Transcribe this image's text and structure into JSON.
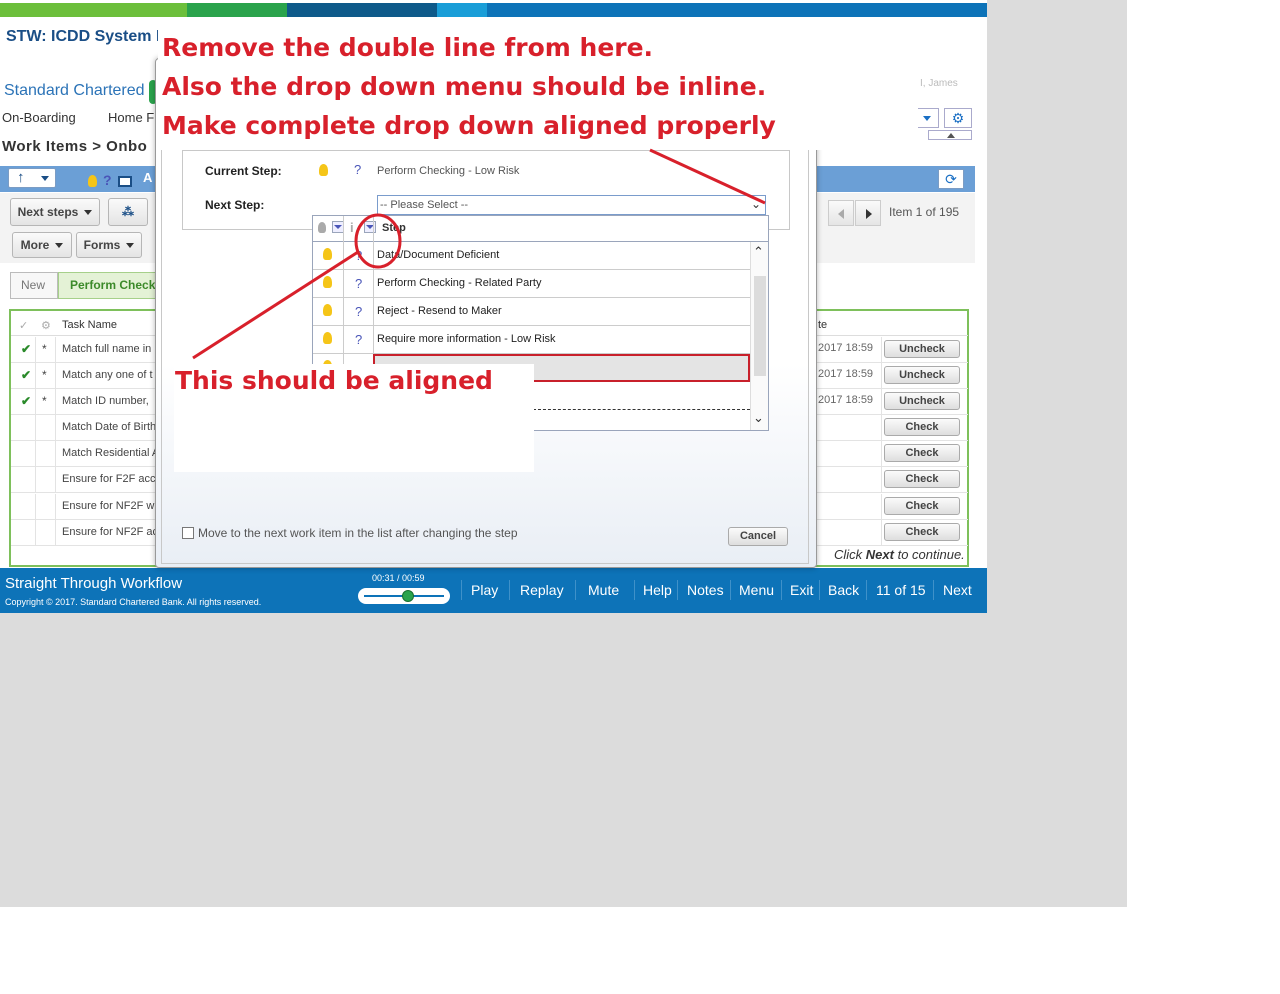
{
  "app": {
    "title": "STW: ICDD System D",
    "brand": "Standard Chartered",
    "user": "I, James"
  },
  "nav": {
    "onboarding": "On-Boarding",
    "home": "Home F"
  },
  "breadcrumb": "Work Items > Onbo",
  "toolbar": {
    "next_steps": "Next steps",
    "more": "More",
    "forms": "Forms",
    "pager_text": "Item 1 of 195"
  },
  "steps": {
    "new": "New",
    "perform": "Perform Check"
  },
  "task_table": {
    "header": {
      "task_name": "Task Name",
      "date": "te"
    },
    "rows": [
      {
        "checked": "✔",
        "star": "*",
        "name": "Match full name in",
        "date": "2017 18:59",
        "action": "Uncheck"
      },
      {
        "checked": "✔",
        "star": "*",
        "name": "Match any one of t",
        "date": "2017 18:59",
        "action": "Uncheck"
      },
      {
        "checked": "✔",
        "star": "*",
        "name": "Match ID number,",
        "date": "2017 18:59",
        "action": "Uncheck"
      },
      {
        "checked": "",
        "star": "",
        "name": "Match Date of Birth",
        "date": "",
        "action": "Check"
      },
      {
        "checked": "",
        "star": "",
        "name": "Match Residential A",
        "date": "",
        "action": "Check"
      },
      {
        "checked": "",
        "star": "",
        "name": "Ensure for F2F acc",
        "date": "",
        "action": "Check"
      },
      {
        "checked": "",
        "star": "",
        "name": "Ensure for NF2F wi",
        "date": "",
        "action": "Check"
      },
      {
        "checked": "",
        "star": "",
        "name": "Ensure for NF2F ac",
        "date": "",
        "action": "Check"
      }
    ]
  },
  "dialog": {
    "current_step_label": "Current Step:",
    "current_step_value": "Perform Checking - Low Risk",
    "next_step_label": "Next Step:",
    "select_placeholder": "-- Please Select --",
    "dropdown_header": "Step",
    "options": [
      "Data/Document Deficient",
      "Perform Checking - Related Party",
      "Reject - Resend to Maker",
      "Require more information - Low Risk"
    ],
    "checkbox_label": "Move to the next work item in the list after changing the step",
    "cancel": "Cancel"
  },
  "annotations": {
    "line1": "Remove the double line from here.",
    "line2": "Also the drop down menu should be inline.",
    "line3": "Make complete drop down aligned properly",
    "aligned": "This should be aligned"
  },
  "click_next": {
    "prefix": "Click ",
    "bold": "Next",
    "suffix": " to continue."
  },
  "footer": {
    "title": "Straight Through Workflow",
    "copyright": "Copyright © 2017. Standard Chartered Bank. All rights reserved.",
    "time": "00:31 / 00:59",
    "play": "Play",
    "replay": "Replay",
    "mute": "Mute",
    "help": "Help",
    "notes": "Notes",
    "menu": "Menu",
    "exit": "Exit",
    "back": "Back",
    "counter": "11 of 15",
    "next": "Next"
  },
  "colors": {
    "footer_bg": "#0d73b8",
    "annotation_red": "#d8202b",
    "accent_green": "#7ec05b"
  }
}
